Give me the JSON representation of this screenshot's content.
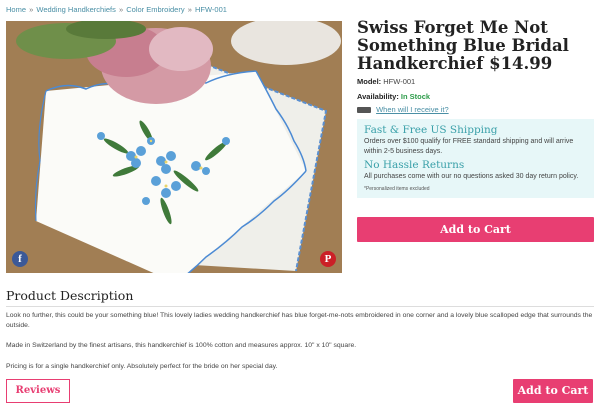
{
  "breadcrumb": {
    "home": "Home",
    "cat1": "Wedding Handkerchiefs",
    "cat2": "Color Embroidery",
    "current": "HFW-001",
    "sep": "»"
  },
  "product": {
    "title": "Swiss Forget Me Not Something Blue Bridal Handkerchief $14.99",
    "model_label": "Model:",
    "model_value": "HFW-001",
    "availability_label": "Availability:",
    "availability_value": "In Stock",
    "receive_link": "When will I receive it?"
  },
  "shipping": {
    "heading1": "Fast & Free US Shipping",
    "text1": "Orders over $100 qualify for FREE standard shipping and will arrive within 2-5 business days.",
    "heading2": "No Hassle Returns",
    "text2": "All purchases come with our no questions asked 30 day return policy.",
    "note": "*Personalized items excluded"
  },
  "buttons": {
    "add_to_cart": "Add to Cart",
    "reviews": "Reviews",
    "add_to_cart_bottom": "Add to Cart"
  },
  "social": {
    "facebook": "f",
    "pinterest": "P"
  },
  "description": {
    "title": "Product Description",
    "p1": "Look no further, this could be your something blue! This lovely ladies wedding handkerchief has blue forget-me-nots embroidered in one corner and a lovely blue scalloped edge that surrounds the outside.",
    "p2": "Made in Switzerland by the finest artisans, this handkerchief is 100% cotton and measures approx. 10\" x 10\" square.",
    "p3": "Pricing is for a single handkerchief only. Absolutely perfect for the bride on her special day."
  },
  "colors": {
    "accent": "#e83e72",
    "link": "#4a8fa5",
    "ship_bg": "#e7f7f8",
    "ship_heading": "#3aa0a9",
    "in_stock": "#2d9c4a"
  }
}
